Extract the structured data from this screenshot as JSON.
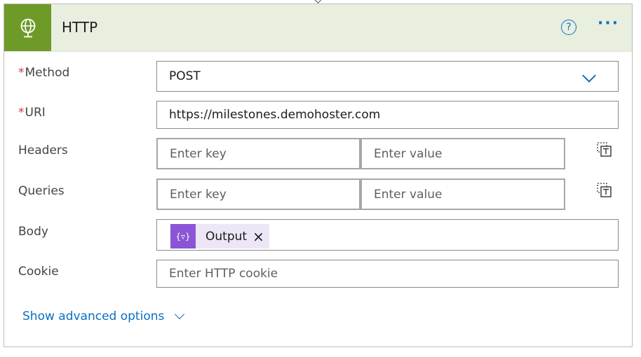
{
  "header": {
    "title": "HTTP",
    "help_glyph": "?",
    "more_glyph": "···",
    "icon": "globe-icon",
    "brand_color": "#6e9a28"
  },
  "fields": {
    "method": {
      "label": "Method",
      "required_mark": "*",
      "value": "POST"
    },
    "uri": {
      "label": "URI",
      "required_mark": "*",
      "value": "https://milestones.demohoster.com"
    },
    "headers": {
      "label": "Headers",
      "key_placeholder": "Enter key",
      "value_placeholder": "Enter value"
    },
    "queries": {
      "label": "Queries",
      "key_placeholder": "Enter key",
      "value_placeholder": "Enter value"
    },
    "body": {
      "label": "Body",
      "token_label": "Output",
      "token_icon_glyph": "{▿}",
      "token_remove_glyph": "×"
    },
    "cookie": {
      "label": "Cookie",
      "placeholder": "Enter HTTP cookie"
    }
  },
  "footer": {
    "advanced_label": "Show advanced options"
  }
}
